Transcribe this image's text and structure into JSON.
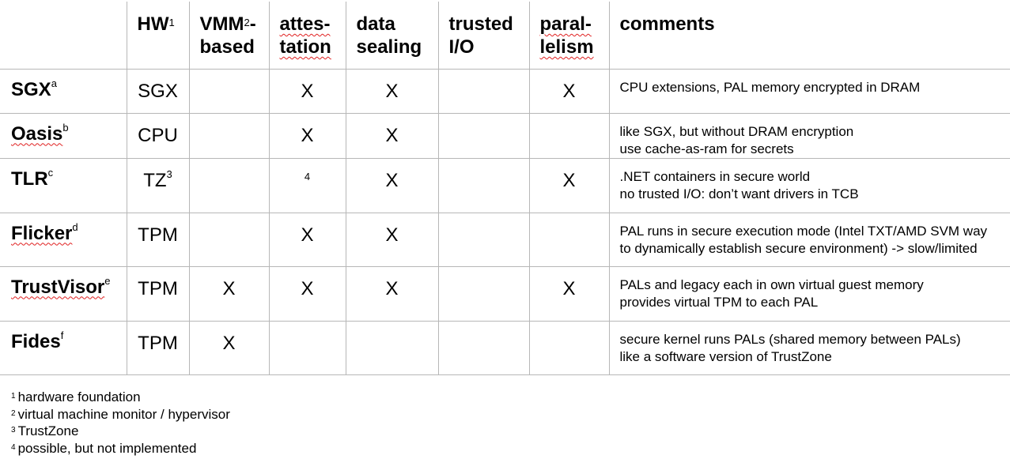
{
  "table": {
    "headers": {
      "hw": "HW",
      "hw_sup": "1",
      "vmm_line1": "VMM",
      "vmm_sup": "2",
      "vmm_dash": "-",
      "vmm_line2": "based",
      "attest_line1": "attes-",
      "attest_line2": "tation",
      "seal_line1": "data",
      "seal_line2": "sealing",
      "io_line1": "trusted",
      "io_line2": "I/O",
      "par_line1": "paral-",
      "par_line2": "lelism",
      "comments": "comments"
    },
    "rows": [
      {
        "name": "SGX",
        "sup": "a",
        "hw": "SGX",
        "hw_sup": "",
        "vmm": "",
        "attest": "X",
        "attest_note": "",
        "seal": "X",
        "io": "",
        "par": "X",
        "c1": "CPU extensions, PAL memory encrypted in DRAM",
        "c2": ""
      },
      {
        "name": "Oasis",
        "sup": "b",
        "hw": "CPU",
        "hw_sup": "",
        "vmm": "",
        "attest": "X",
        "attest_note": "",
        "seal": "X",
        "io": "",
        "par": "",
        "c1": "like SGX, but without DRAM encryption",
        "c2": "use cache-as-ram for secrets"
      },
      {
        "name": "TLR",
        "sup": "c",
        "hw": "TZ",
        "hw_sup": "3",
        "vmm": "",
        "attest": "",
        "attest_note": "4",
        "seal": "X",
        "io": "",
        "par": "X",
        "c1": ".NET containers in secure world",
        "c2": "no trusted I/O: don’t want drivers in TCB"
      },
      {
        "name": "Flicker",
        "sup": "d",
        "hw": "TPM",
        "hw_sup": "",
        "vmm": "",
        "attest": "X",
        "attest_note": "",
        "seal": "X",
        "io": "",
        "par": "",
        "c1": "PAL runs in secure execution mode (Intel TXT/AMD SVM way",
        "c2": "to dynamically establish secure environment) -> slow/limited"
      },
      {
        "name": "TrustVisor",
        "sup": "e",
        "hw": "TPM",
        "hw_sup": "",
        "vmm": "X",
        "attest": "X",
        "attest_note": "",
        "seal": "X",
        "io": "",
        "par": "X",
        "c1": "PALs and legacy each in own virtual guest memory",
        "c2": "provides virtual TPM to each PAL"
      },
      {
        "name": "Fides",
        "sup": "f",
        "hw": "TPM",
        "hw_sup": "",
        "vmm": "X",
        "attest": "",
        "attest_note": "",
        "seal": "",
        "io": "",
        "par": "",
        "c1": "secure kernel runs PALs (shared memory between PALs)",
        "c2": "like a software version of TrustZone"
      }
    ]
  },
  "footnotes": [
    {
      "mark": "1",
      "text": "hardware foundation"
    },
    {
      "mark": "2",
      "text": "virtual machine monitor / hypervisor"
    },
    {
      "mark": "3",
      "text": "TrustZone"
    },
    {
      "mark": "4",
      "text": "possible, but not implemented"
    }
  ]
}
